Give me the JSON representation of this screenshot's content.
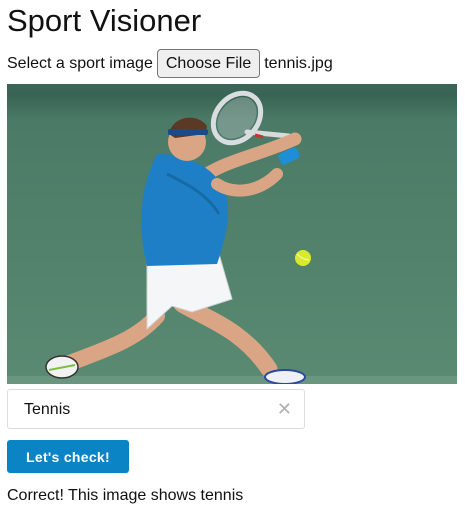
{
  "header": {
    "title": "Sport Visioner"
  },
  "upload": {
    "label": "Select a sport image",
    "button_label": "Choose File",
    "file_name": "tennis.jpg"
  },
  "image": {
    "subject": "tennis player hitting a forehand on a green hard court"
  },
  "sport_select": {
    "value": "Tennis",
    "clear_icon": "close-icon"
  },
  "actions": {
    "check_label": "Let's check!"
  },
  "result": {
    "text": "Correct! This image shows tennis"
  },
  "colors": {
    "button_blue": "#0b84c6",
    "court_green": "#4f8069"
  }
}
